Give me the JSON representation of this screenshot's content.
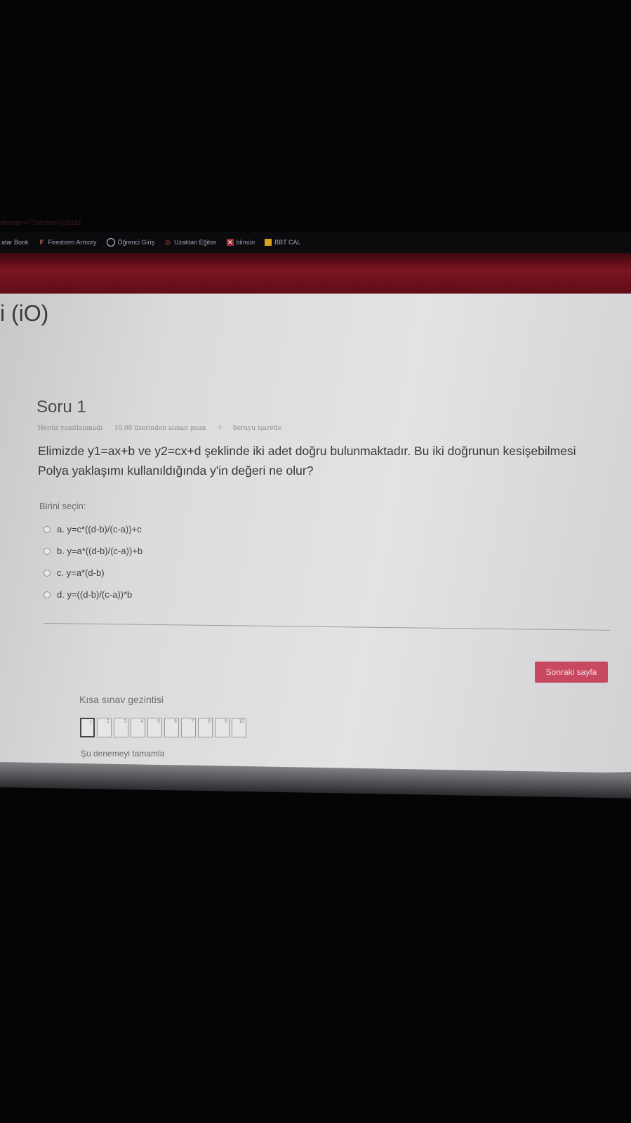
{
  "browser": {
    "url_fragment": "attempt=4779&cmid=329182",
    "bookmarks": [
      {
        "label": "atar Book",
        "icon": "none"
      },
      {
        "label": "Firestorm Armory",
        "icon": "f-icon"
      },
      {
        "label": "Öğrenci Giriş",
        "icon": "globe-icon"
      },
      {
        "label": "Uzaktan Eğitim",
        "icon": "uzaktan-icon"
      },
      {
        "label": "bilmün",
        "icon": "bilmun-icon"
      },
      {
        "label": "BBT CAL",
        "icon": "folder-icon"
      }
    ]
  },
  "colors": {
    "header_band": "#7a1420",
    "next_button": "#c94861",
    "page_background": "#e3e3e4"
  },
  "course": {
    "title": "i (iO)"
  },
  "question": {
    "title": "Soru 1",
    "status": "Henüz yanıtlanmadı",
    "points": "10.00 üzerinden alınan puan",
    "flag_label": "Soruyu işaretle",
    "text": "Elimizde y1=ax+b ve y2=cx+d şeklinde iki adet doğru bulunmaktadır. Bu iki doğrunun kesişebilmesi Polya yaklaşımı kullanıldığında y'in değeri ne olur?",
    "choose_label": "Birini seçin:",
    "answers": [
      "a. y=c*((d-b)/(c-a))+c",
      "b. y=a*((d-b)/(c-a))+b",
      "c. y=a*(d-b)",
      "d. y=((d-b)/(c-a))*b"
    ]
  },
  "navigation": {
    "next_button": "Sonraki sayfa",
    "title": "Kısa sınav gezintisi",
    "pages": [
      "1",
      "2",
      "3",
      "4",
      "5",
      "6",
      "7",
      "8",
      "9",
      "10"
    ],
    "current_page": "1",
    "finish_link": "Şu denemeyi tamamla",
    "finish_ellipsis": "..."
  }
}
